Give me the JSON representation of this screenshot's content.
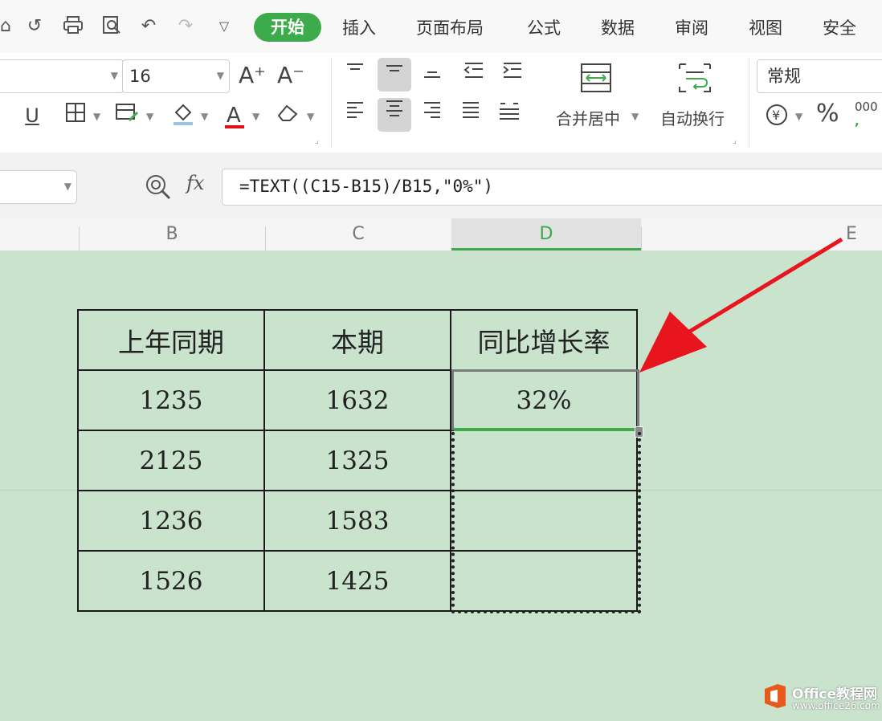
{
  "tabs": [
    "开始",
    "插入",
    "页面布局",
    "公式",
    "数据",
    "审阅",
    "视图",
    "安全"
  ],
  "ribbon": {
    "font_size": "16",
    "number_format": "常规",
    "merge_label": "合并居中",
    "wrap_label": "自动换行",
    "percent_label": "%",
    "thousands_label": "000",
    "font_color": "#e01010"
  },
  "formula": {
    "fx_label": "fx",
    "text": "=TEXT((C15-B15)/B15,\"0%\")"
  },
  "columns": [
    "B",
    "C",
    "D",
    "E"
  ],
  "table": {
    "headers": [
      "上年同期",
      "本期",
      "同比增长率"
    ],
    "rows": [
      [
        "1235",
        "1632",
        "32%"
      ],
      [
        "2125",
        "1325",
        ""
      ],
      [
        "1236",
        "1583",
        ""
      ],
      [
        "1526",
        "1425",
        ""
      ]
    ]
  },
  "watermark": {
    "brand": "Office教程网",
    "url": "www.office26.com"
  },
  "colors": {
    "accent": "#3dab4c",
    "sheet_bg": "#c9e3cd",
    "arrow": "#e8141e"
  }
}
